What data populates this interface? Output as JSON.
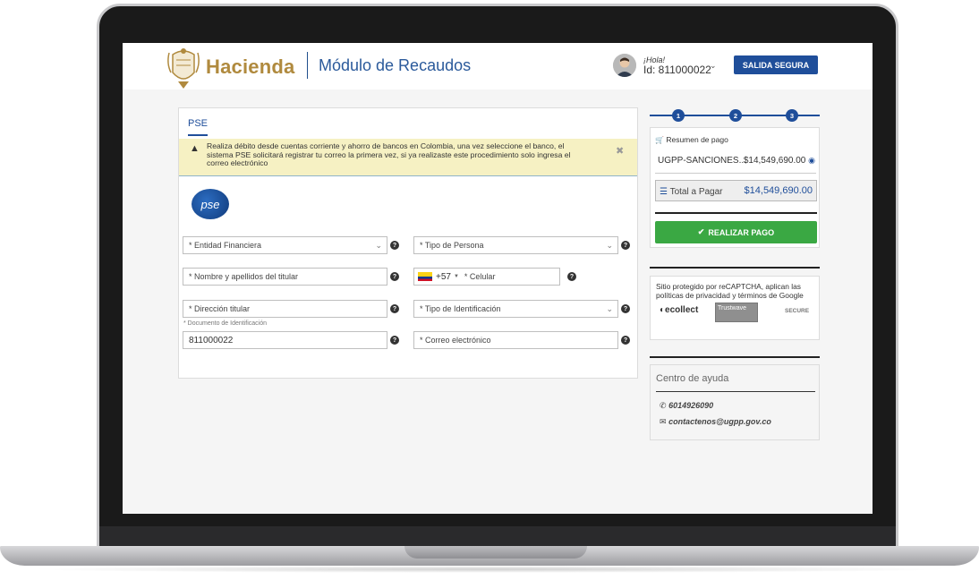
{
  "header": {
    "logo_text": "Hacienda",
    "module_title": "Módulo de Recaudos",
    "greeting": "¡Hola!",
    "user_id": "Id: 811000022",
    "logout_label": "SALIDA SEGURA"
  },
  "payment": {
    "tab_label": "PSE",
    "alert_text": "Realiza débito desde cuentas corriente y ahorro de bancos en Colombia, una vez seleccione el banco, el sistema PSE solicitará registrar tu correo la primera vez, si ya realizaste este procedimiento solo ingresa el correo electrónico",
    "pse_logo_text": "pse",
    "fields": {
      "bank": "* Entidad Financiera",
      "person_type": "* Tipo de Persona",
      "holder_name": "* Nombre y apellidos del titular",
      "phone_prefix": "+57",
      "phone": "* Celular",
      "address": "* Dirección titular",
      "id_type": "* Tipo de Identificación",
      "doc_label": "* Documento de Identificación",
      "doc_value": "811000022",
      "email": "* Correo electrónico"
    }
  },
  "steps": [
    "1",
    "2",
    "3"
  ],
  "summary": {
    "title": "Resumen de pago",
    "item_name": "UGPP-SANCIONES...",
    "item_amount": "$14,549,690.00",
    "total_label": "Total a Pagar",
    "total_amount": "$14,549,690.00",
    "pay_button": "REALIZAR PAGO"
  },
  "security": {
    "text": "Sitio protegido por reCAPTCHA, aplican las políticas de privacidad y términos de Google",
    "badges": [
      "ecollect",
      "Trustwave",
      "SECURE"
    ]
  },
  "help_center": {
    "title": "Centro de ayuda",
    "phone": "6014926090",
    "email": "contactenos@ugpp.gov.co"
  },
  "colors": {
    "primary": "#1f4e9a",
    "gold": "#b08a3e",
    "success": "#3aa843",
    "alert_bg": "#f6f1c3"
  }
}
